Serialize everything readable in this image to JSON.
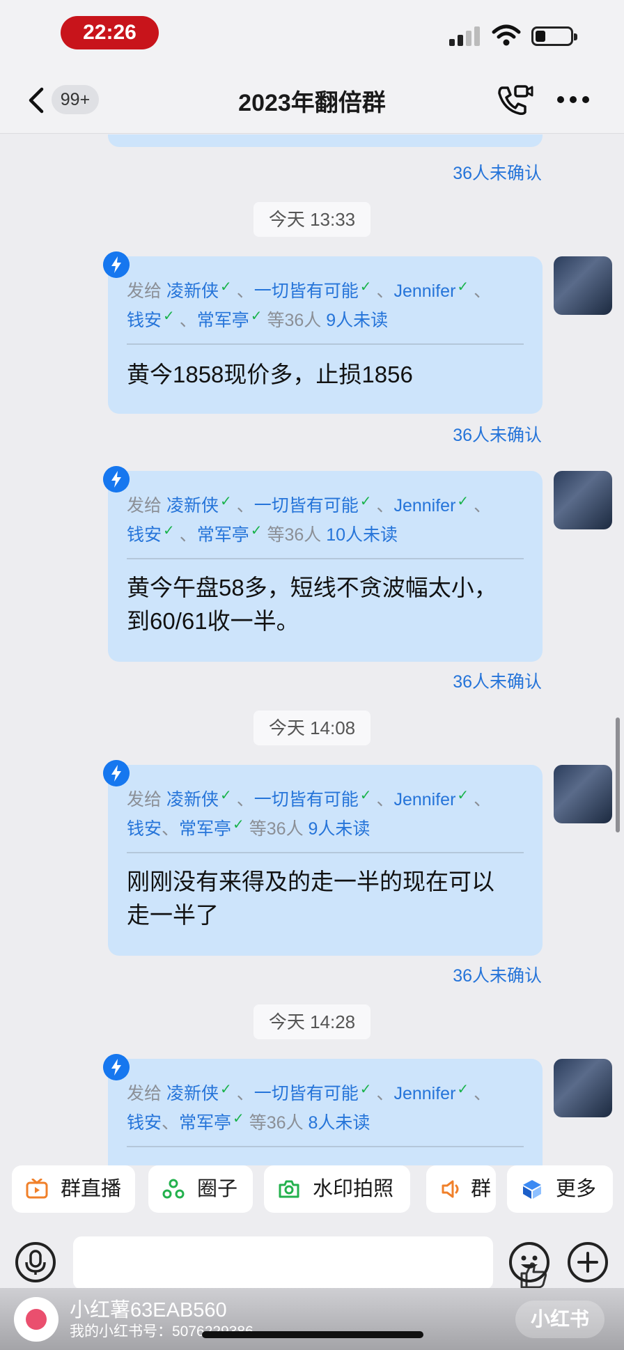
{
  "status": {
    "time": "22:26"
  },
  "nav": {
    "back_badge": "99+",
    "title": "2023年翻倍群"
  },
  "chat": {
    "top_confirm": "36人未确认",
    "messages": [
      {
        "recipients_line1": [
          "凌新侠",
          "一切皆有可能",
          "Jennifer"
        ],
        "recipients_line2": [
          "钱安",
          "常军亭"
        ],
        "total": "等36人",
        "unread": "9人未读",
        "text": "黄今1858现价多，止损1856",
        "confirm": "36人未确认"
      },
      {
        "recipients_line1": [
          "凌新侠",
          "一切皆有可能",
          "Jennifer"
        ],
        "recipients_line2": [
          "钱安",
          "常军亭"
        ],
        "total": "等36人",
        "unread": "10人未读",
        "text": "黄今午盘58多，短线不贪波幅太小，到60/61收一半。",
        "confirm": "36人未确认"
      },
      {
        "recipients_line1": [
          "凌新侠",
          "一切皆有可能",
          "Jennifer"
        ],
        "recipients_line2": [
          "钱安",
          "常军亭"
        ],
        "total": "等36人",
        "unread": "9人未读",
        "text": "刚刚没有来得及的走一半的现在可以走一半了",
        "confirm": "36人未确认"
      },
      {
        "recipients_line1": [
          "凌新侠",
          "一切皆有可能",
          "Jennifer"
        ],
        "recipients_line2": [
          "钱安",
          "常军亭"
        ],
        "total": "等36人",
        "unread": "8人未读"
      }
    ],
    "timestamps": [
      "今天 13:33",
      "今天 14:08",
      "今天 14:28"
    ],
    "send_to": "发给",
    "separator": "、"
  },
  "quickbar": {
    "live": "群直播",
    "circle": "圈子",
    "camera": "水印拍照",
    "notice": "群",
    "more": "更多"
  },
  "footer": {
    "name": "小红薯63EAB560",
    "id": "我的小红书号：5076229386",
    "logo": "小红书"
  },
  "colors": {
    "accent": "#2574d9",
    "bubble": "#cde4fb",
    "check": "#19b34b",
    "time_pill": "#c8141b"
  }
}
